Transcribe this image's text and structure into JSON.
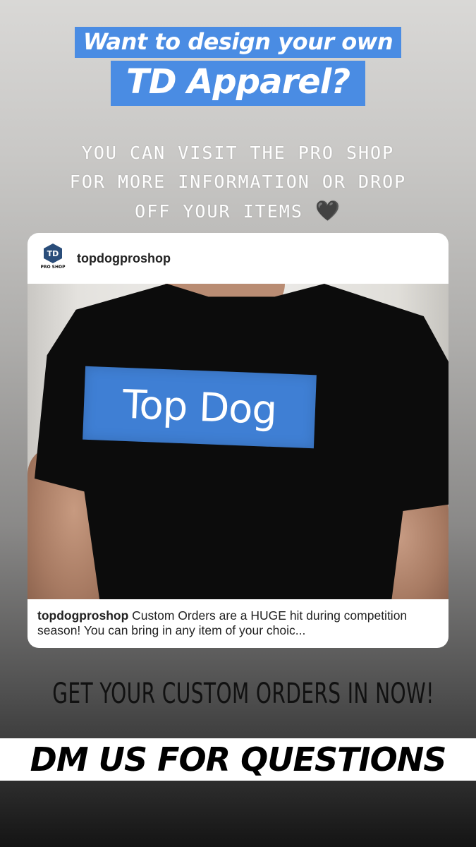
{
  "headline": {
    "line1": "Want to design your own",
    "line2": "TD Apparel?",
    "accent_color": "#4a8ce3"
  },
  "subtext": {
    "line1": "YOU CAN VISIT THE PRO SHOP",
    "line2": "FOR MORE INFORMATION OR DROP",
    "line3": "OFF YOUR ITEMS",
    "emoji": "🖤"
  },
  "post": {
    "username": "topdogproshop",
    "avatar_text": "TD",
    "avatar_caption": "PRO SHOP",
    "shirt_print": "Top Dog",
    "caption_user": "topdogproshop",
    "caption_text": " Custom Orders are a HUGE hit during competition season! You can bring in any item of your choic..."
  },
  "cta": {
    "line1": "GET YOUR CUSTOM ORDERS IN NOW!",
    "line2": "DM US FOR QUESTIONS"
  }
}
